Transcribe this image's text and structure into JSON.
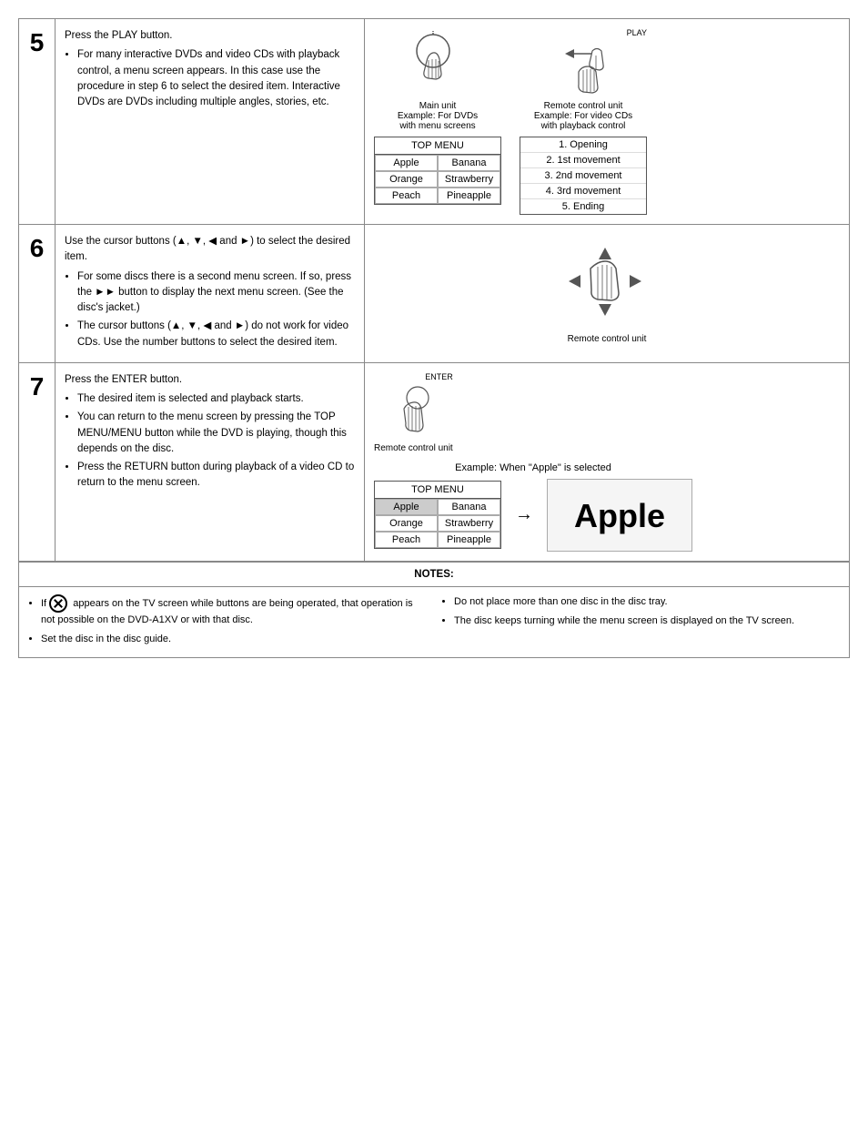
{
  "steps": [
    {
      "number": "5",
      "text_paragraphs": [
        "Press the PLAY button.",
        "For many interactive DVDs and video CDs with playback control, a menu screen appears. In this case use the procedure in step 6 to select the desired item. Interactive DVDs are DVDs including multiple angles, stories, etc."
      ],
      "left_diagram_label": "Main unit",
      "left_diagram_sub": "Example: For DVDs with menu screens",
      "right_diagram_label": "Remote control unit",
      "right_diagram_sub": "Example: For video CDs with playback control",
      "top_menu": {
        "title": "TOP MENU",
        "cells": [
          "Apple",
          "Banana",
          "Orange",
          "Strawberry",
          "Peach",
          "Pineapple"
        ],
        "selected": ""
      },
      "playlist": {
        "items": [
          "1. Opening",
          "2. 1st movement",
          "3. 2nd movement",
          "4. 3rd movement",
          "5. Ending"
        ]
      }
    },
    {
      "number": "6",
      "text_paragraphs": [
        "Use the cursor buttons (▲, ▼, ◀ and ►) to select the desired item.",
        "For some discs there is a second menu screen. If so, press the ►► button to display the next menu screen. (See the disc's jacket.)",
        "The cursor buttons (▲, ▼, ◀ and ►) do not work for video CDs. Use the number buttons to select the desired item."
      ],
      "right_label": "Remote control unit"
    },
    {
      "number": "7",
      "text_paragraphs": [
        "Press the ENTER button.",
        "The desired item is selected and playback starts.",
        "You can return to the menu screen by pressing the TOP MENU/MENU button while the DVD is playing, though this depends on the disc.",
        "Press the RETURN button during playback of a video CD to return to the menu screen."
      ],
      "example_label": "Example: When \"Apple\" is selected",
      "right_label": "Remote control unit",
      "top_menu": {
        "title": "TOP MENU",
        "cells": [
          "Apple",
          "Banana",
          "Orange",
          "Strawberry",
          "Peach",
          "Pineapple"
        ],
        "selected": "Apple"
      },
      "result": "Apple"
    }
  ],
  "notes": {
    "title": "NOTES:",
    "left_items": [
      "If [icon] appears on the TV screen while buttons are being operated, that operation is not possible on the DVD-A1XV or with that disc.",
      "Set the disc in the disc guide."
    ],
    "right_items": [
      "Do not place more than one disc in the disc tray.",
      "The disc keeps turning while the menu screen is displayed on the TV screen."
    ]
  }
}
